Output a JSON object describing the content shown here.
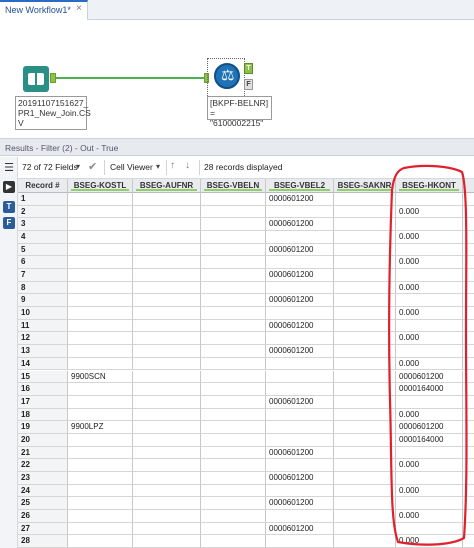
{
  "tab": {
    "title": "New Workflow1*",
    "close": "×"
  },
  "canvas": {
    "input_annotation": "20191107151627_ PR1_New_Join.CS V",
    "filter_annotation": "[BKPF-BELNR] = \"6100002215\"",
    "t_label": "T",
    "f_label": "F"
  },
  "results": {
    "header": "Results - Filter (2) - Out - True",
    "fields_label": "72 of 72 Fields",
    "cell_viewer_label": "Cell Viewer",
    "records_label": "28 records displayed"
  },
  "rail": {
    "t_label": "T",
    "f_label": "F"
  },
  "grid": {
    "columns": [
      "Record #",
      "BSEG-KOSTL",
      "BSEG-AUFNR",
      "BSEG-VBELN",
      "BSEG-VBEL2",
      "BSEG-SAKNR",
      "BSEG-HKONT"
    ],
    "rows": [
      [
        "1",
        "",
        "",
        "",
        "0000601200",
        "",
        ""
      ],
      [
        "2",
        "",
        "",
        "",
        "",
        "",
        "0.000"
      ],
      [
        "3",
        "",
        "",
        "",
        "0000601200",
        "",
        ""
      ],
      [
        "4",
        "",
        "",
        "",
        "",
        "",
        "0.000"
      ],
      [
        "5",
        "",
        "",
        "",
        "0000601200",
        "",
        ""
      ],
      [
        "6",
        "",
        "",
        "",
        "",
        "",
        "0.000"
      ],
      [
        "7",
        "",
        "",
        "",
        "0000601200",
        "",
        ""
      ],
      [
        "8",
        "",
        "",
        "",
        "",
        "",
        "0.000"
      ],
      [
        "9",
        "",
        "",
        "",
        "0000601200",
        "",
        ""
      ],
      [
        "10",
        "",
        "",
        "",
        "",
        "",
        "0.000"
      ],
      [
        "11",
        "",
        "",
        "",
        "0000601200",
        "",
        ""
      ],
      [
        "12",
        "",
        "",
        "",
        "",
        "",
        "0.000"
      ],
      [
        "13",
        "",
        "",
        "",
        "0000601200",
        "",
        ""
      ],
      [
        "14",
        "",
        "",
        "",
        "",
        "",
        "0.000"
      ],
      [
        "15",
        "9900SCN",
        "",
        "",
        "",
        "",
        "0000601200"
      ],
      [
        "16",
        "",
        "",
        "",
        "",
        "",
        "0000164000"
      ],
      [
        "17",
        "",
        "",
        "",
        "0000601200",
        "",
        ""
      ],
      [
        "18",
        "",
        "",
        "",
        "",
        "",
        "0.000"
      ],
      [
        "19",
        "9900LPZ",
        "",
        "",
        "",
        "",
        "0000601200"
      ],
      [
        "20",
        "",
        "",
        "",
        "",
        "",
        "0000164000"
      ],
      [
        "21",
        "",
        "",
        "",
        "0000601200",
        "",
        ""
      ],
      [
        "22",
        "",
        "",
        "",
        "",
        "",
        "0.000"
      ],
      [
        "23",
        "",
        "",
        "",
        "0000601200",
        "",
        ""
      ],
      [
        "24",
        "",
        "",
        "",
        "",
        "",
        "0.000"
      ],
      [
        "25",
        "",
        "",
        "",
        "0000601200",
        "",
        ""
      ],
      [
        "26",
        "",
        "",
        "",
        "",
        "",
        "0.000"
      ],
      [
        "27",
        "",
        "",
        "",
        "0000601200",
        "",
        ""
      ],
      [
        "28",
        "",
        "",
        "",
        "",
        "",
        "0.000"
      ]
    ]
  },
  "colors": {
    "accent": "#2a6cc4",
    "highlight": "#e0202a",
    "connector": "#4caf50"
  }
}
